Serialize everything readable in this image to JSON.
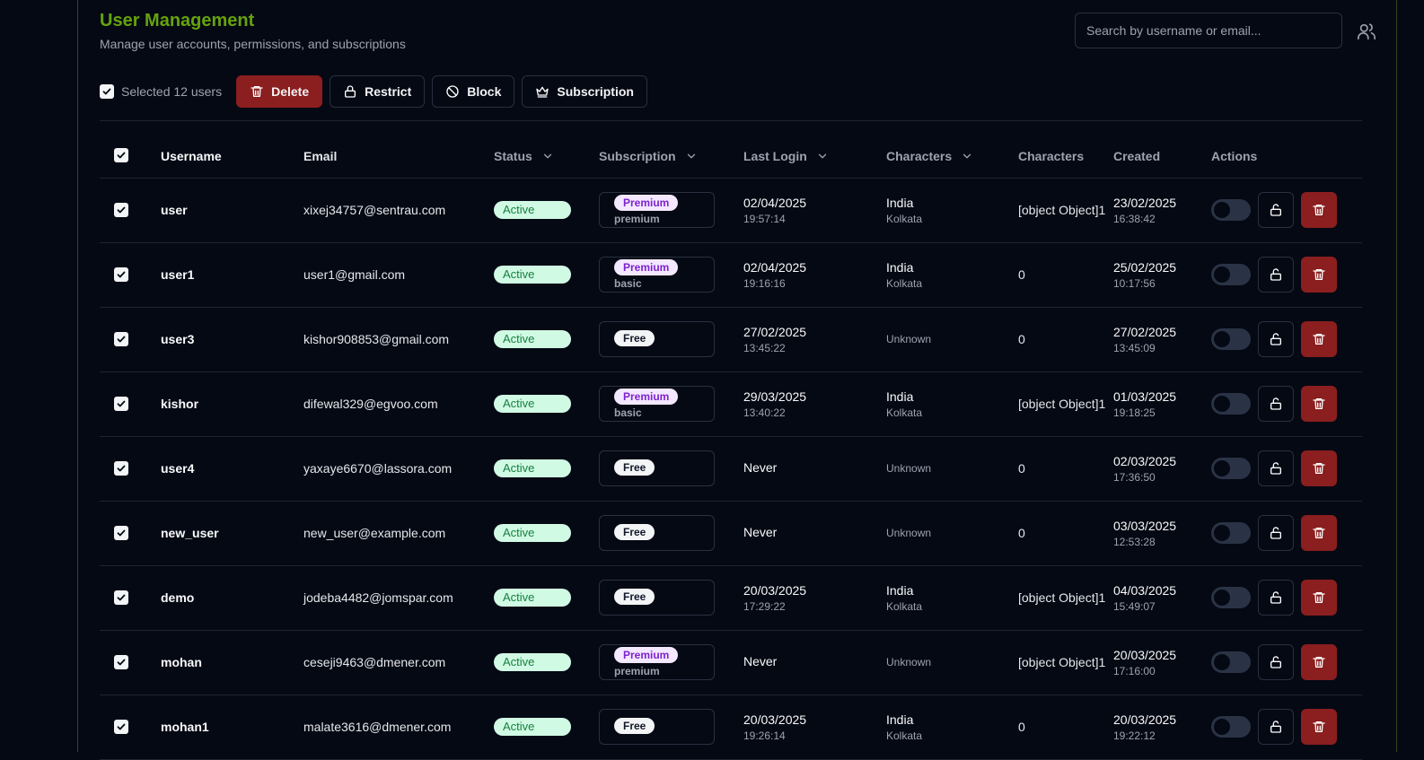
{
  "header": {
    "title": "User Management",
    "subtitle": "Manage user accounts, permissions, and subscriptions",
    "search_placeholder": "Search by username or email..."
  },
  "toolbar": {
    "selected_label": "Selected 12 users",
    "delete_label": "Delete",
    "restrict_label": "Restrict",
    "block_label": "Block",
    "subscription_label": "Subscription"
  },
  "table": {
    "columns": {
      "username": "Username",
      "email": "Email",
      "status": "Status",
      "subscription": "Subscription",
      "last_login": "Last Login",
      "characters_location": "Characters",
      "characters": "Characters",
      "created": "Created",
      "actions": "Actions"
    },
    "rows": [
      {
        "username": "user",
        "email": "xixej34757@sentrau.com",
        "status": "Active",
        "sub_badge": "Premium",
        "sub_plan": "premium",
        "login_date": "02/04/2025",
        "login_time": "19:57:14",
        "country": "India",
        "city": "Kolkata",
        "chars": "[object Object]1",
        "created_date": "23/02/2025",
        "created_time": "16:38:42"
      },
      {
        "username": "user1",
        "email": "user1@gmail.com",
        "status": "Active",
        "sub_badge": "Premium",
        "sub_plan": "basic",
        "login_date": "02/04/2025",
        "login_time": "19:16:16",
        "country": "India",
        "city": "Kolkata",
        "chars": "0",
        "created_date": "25/02/2025",
        "created_time": "10:17:56"
      },
      {
        "username": "user3",
        "email": "kishor908853@gmail.com",
        "status": "Active",
        "sub_badge": "Free",
        "sub_plan": "",
        "login_date": "27/02/2025",
        "login_time": "13:45:22",
        "country": "",
        "city": "Unknown",
        "chars": "0",
        "created_date": "27/02/2025",
        "created_time": "13:45:09"
      },
      {
        "username": "kishor",
        "email": "difewal329@egvoo.com",
        "status": "Active",
        "sub_badge": "Premium",
        "sub_plan": "basic",
        "login_date": "29/03/2025",
        "login_time": "13:40:22",
        "country": "India",
        "city": "Kolkata",
        "chars": "[object Object]1",
        "created_date": "01/03/2025",
        "created_time": "19:18:25"
      },
      {
        "username": "user4",
        "email": "yaxaye6670@lassora.com",
        "status": "Active",
        "sub_badge": "Free",
        "sub_plan": "",
        "login_date": "Never",
        "login_time": "",
        "country": "",
        "city": "Unknown",
        "chars": "0",
        "created_date": "02/03/2025",
        "created_time": "17:36:50"
      },
      {
        "username": "new_user",
        "email": "new_user@example.com",
        "status": "Active",
        "sub_badge": "Free",
        "sub_plan": "",
        "login_date": "Never",
        "login_time": "",
        "country": "",
        "city": "Unknown",
        "chars": "0",
        "created_date": "03/03/2025",
        "created_time": "12:53:28"
      },
      {
        "username": "demo",
        "email": "jodeba4482@jomspar.com",
        "status": "Active",
        "sub_badge": "Free",
        "sub_plan": "",
        "login_date": "20/03/2025",
        "login_time": "17:29:22",
        "country": "India",
        "city": "Kolkata",
        "chars": "[object Object]1",
        "created_date": "04/03/2025",
        "created_time": "15:49:07"
      },
      {
        "username": "mohan",
        "email": "ceseji9463@dmener.com",
        "status": "Active",
        "sub_badge": "Premium",
        "sub_plan": "premium",
        "login_date": "Never",
        "login_time": "",
        "country": "",
        "city": "Unknown",
        "chars": "[object Object]1",
        "created_date": "20/03/2025",
        "created_time": "17:16:00"
      },
      {
        "username": "mohan1",
        "email": "malate3616@dmener.com",
        "status": "Active",
        "sub_badge": "Free",
        "sub_plan": "",
        "login_date": "20/03/2025",
        "login_time": "19:26:14",
        "country": "India",
        "city": "Kolkata",
        "chars": "0",
        "created_date": "20/03/2025",
        "created_time": "19:22:12"
      }
    ]
  }
}
